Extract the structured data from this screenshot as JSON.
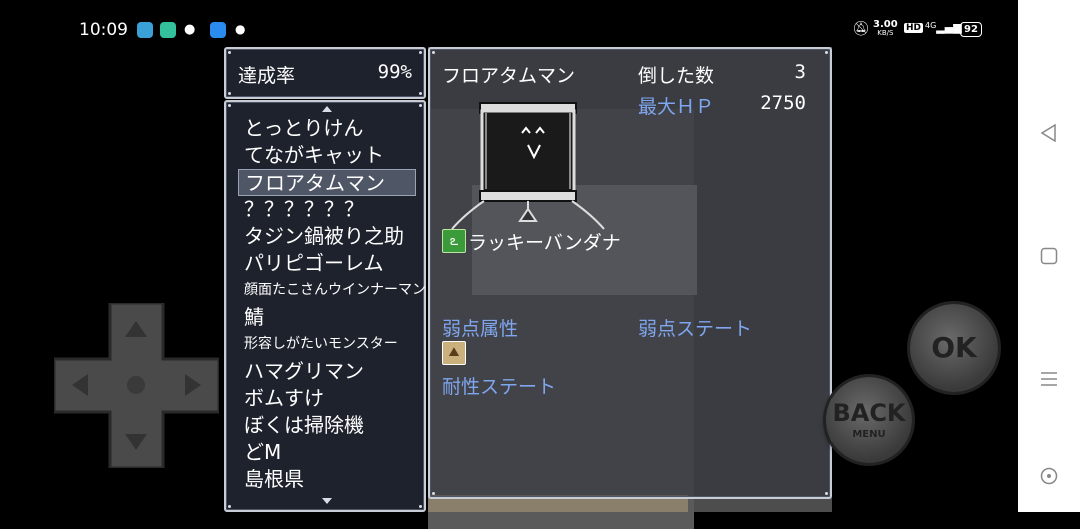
{
  "status_bar": {
    "time": "10:09",
    "net_speed": "3.00",
    "net_unit": "KB/S",
    "hd": "HD",
    "signal": "4G",
    "battery": "92"
  },
  "completion": {
    "label": "達成率",
    "value": "99%"
  },
  "monster_list": [
    "とっとりけん",
    "てながキャット",
    "フロアタムマン",
    "？？？？？？",
    "タジン鍋被り之助",
    "パリピゴーレム",
    "顔面たこさんウインナーマン",
    "鯖",
    "形容しがたいモンスター",
    "ハマグリマン",
    "ボムすけ",
    "ぼくは掃除機",
    "どM",
    "島根県"
  ],
  "selected_index": 2,
  "detail": {
    "name": "フロアタムマン",
    "defeated_label": "倒した数",
    "defeated_value": "3",
    "max_hp_label": "最大ＨＰ",
    "max_hp_value": "2750",
    "drop_item": "ラッキーバンダナ",
    "weak_element_label": "弱点属性",
    "weak_state_label": "弱点ステート",
    "resist_state_label": "耐性ステート"
  },
  "controls": {
    "ok": "OK",
    "back": "BACK",
    "back_sub": "MENU"
  },
  "colors": {
    "accent_blue": "#7fa6ee",
    "window_bg": "#232834"
  }
}
